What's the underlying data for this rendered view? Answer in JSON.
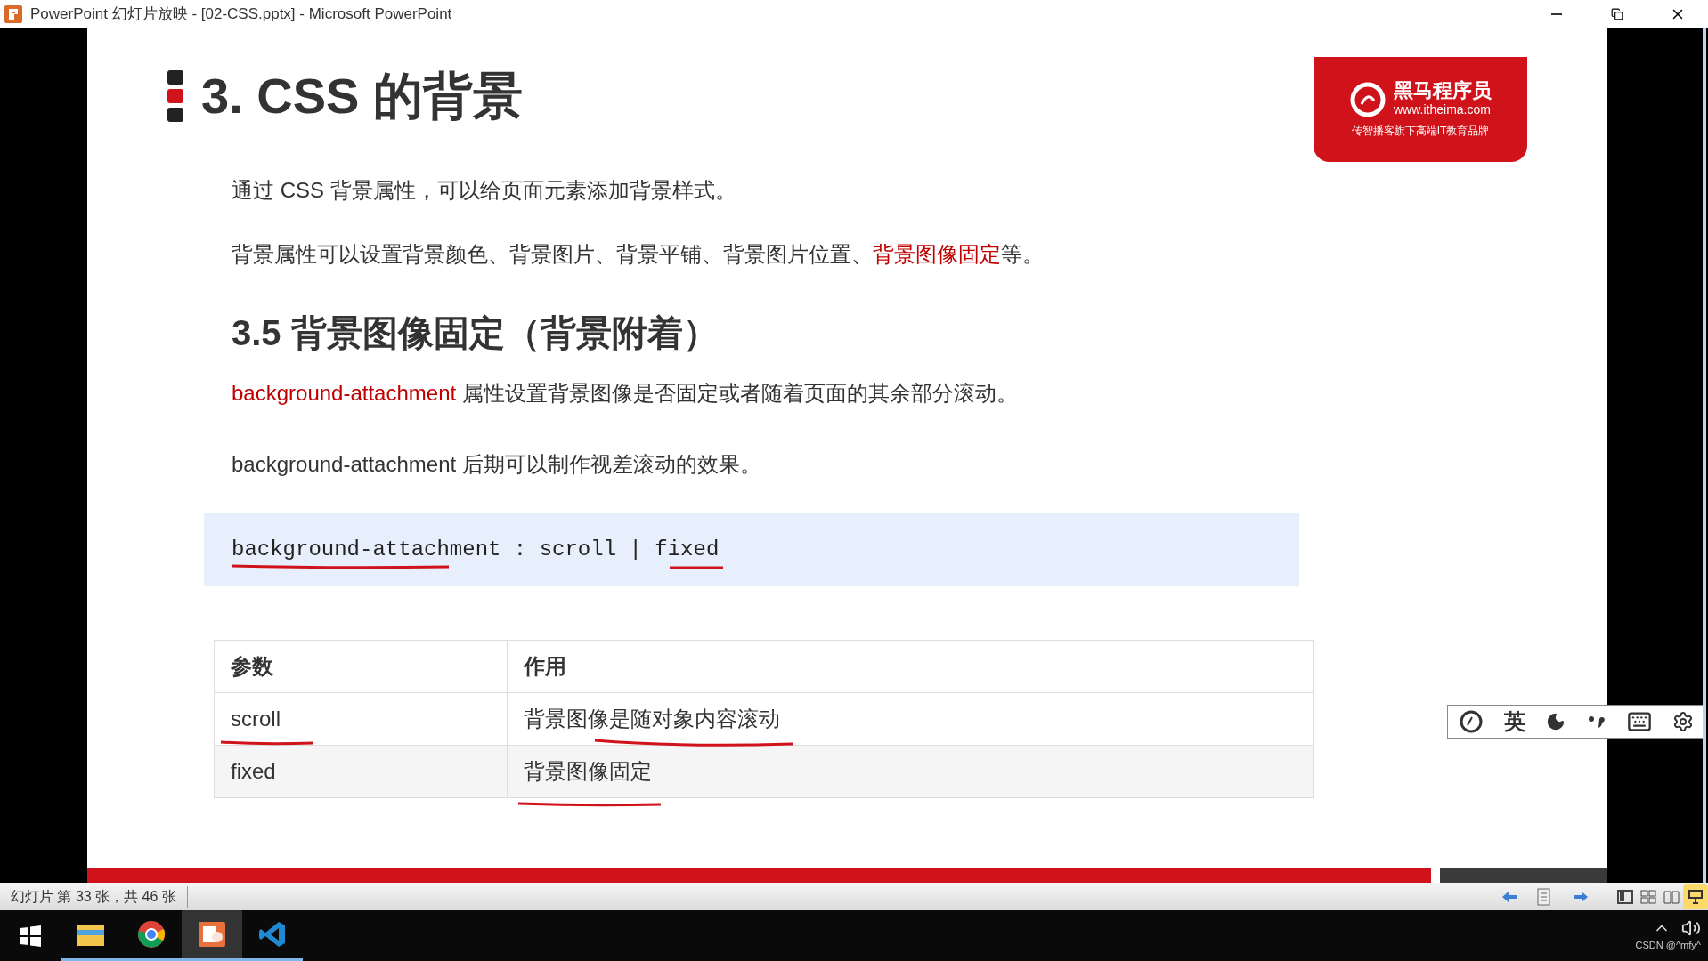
{
  "window": {
    "title": "PowerPoint 幻灯片放映 - [02-CSS.pptx] - Microsoft PowerPoint"
  },
  "slide": {
    "title": "3. CSS 的背景",
    "logo": {
      "brand": "黑马程序员",
      "url": "www.itheima.com",
      "slogan": "传智播客旗下高端IT教育品牌"
    },
    "paragraphs": [
      [
        {
          "text": "通过 CSS 背景属性，可以给页面元素添加背景样式。",
          "highlight": false
        }
      ],
      [
        {
          "text": "背景属性可以设置背景颜色、背景图片、背景平铺、背景图片位置、",
          "highlight": false
        },
        {
          "text": "背景图像固定",
          "highlight": true
        },
        {
          "text": "等。",
          "highlight": false
        }
      ]
    ],
    "heading": "3.5 背景图像固定（背景附着）",
    "paragraphs2": [
      [
        {
          "text": "background-attachment",
          "highlight": true
        },
        {
          "text": " 属性设置背景图像是否固定或者随着页面的其余部分滚动。",
          "highlight": false
        }
      ],
      [
        {
          "text": "background-attachment 后期可以制作视差滚动的效果。",
          "highlight": false
        }
      ]
    ],
    "code": "background-attachment : scroll | fixed",
    "table": {
      "columns": [
        "参数",
        "作用"
      ],
      "rows": [
        [
          "scroll",
          "背景图像是随对象内容滚动"
        ],
        [
          "fixed",
          "背景图像固定"
        ]
      ]
    }
  },
  "progress": {
    "level": 0.89
  },
  "ime": {
    "mode": "英"
  },
  "status_bar": {
    "text": "幻灯片 第 33 张，共 46 张"
  },
  "taskbar": {
    "apps": [
      {
        "kind": "explorer",
        "selected": false
      },
      {
        "kind": "chrome",
        "selected": false
      },
      {
        "kind": "powerpoint",
        "selected": true
      },
      {
        "kind": "vscode",
        "selected": false
      }
    ],
    "tray_text": "CSDN @^mfy^"
  }
}
